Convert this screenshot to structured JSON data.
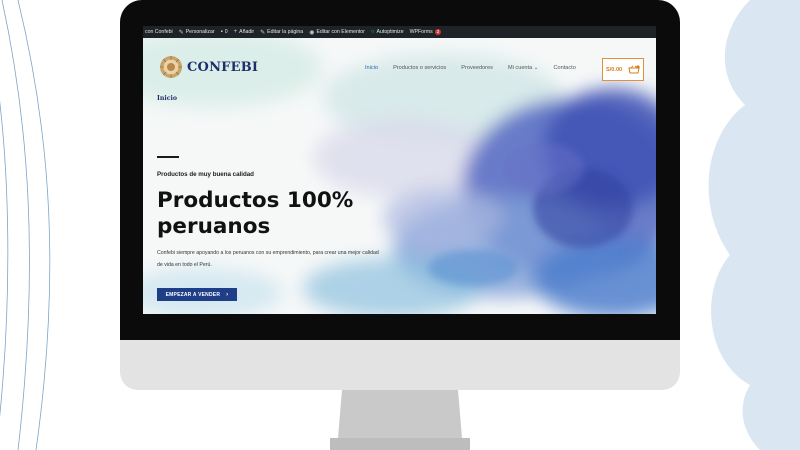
{
  "admin_bar": {
    "site": "con Confebi",
    "customize": "Personalizar",
    "comments": "0",
    "add_new": "Añadir",
    "edit_page": "Editar la página",
    "edit_elementor": "Editar con Elementor",
    "autoptimize": "Autoptimize",
    "wpforms": "WPForms",
    "wpforms_badge": "2"
  },
  "header": {
    "logo_text": "CONFEBI",
    "nav": [
      "Inicio",
      "Productos o servicios",
      "Proveedores",
      "Mi cuenta ⌄",
      "Contacto"
    ],
    "cart_total": "S/0.00"
  },
  "breadcrumb": "Inicio",
  "hero": {
    "eyebrow": "Productos de muy buena calidad",
    "headline": "Productos 100% peruanos",
    "body": "Confebi siempre apoyando a los peruanos con su emprendimiento, para crear una mejor calidad de vida en todo el Perú.",
    "cta": "EMPEZAR A VENDER",
    "cta_icon": "chevron-right-icon"
  },
  "colors": {
    "brand_navy": "#1f2f6b",
    "button_blue": "#1e3f88",
    "nav_active": "#2f62b7",
    "cart_orange": "#e0923a",
    "admin_bar": "#1d2327"
  }
}
